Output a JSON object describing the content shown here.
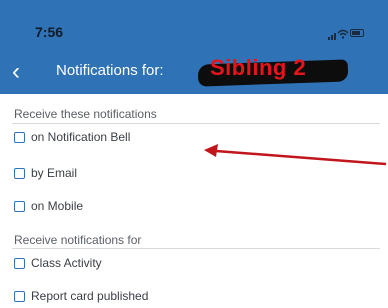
{
  "status_bar": {
    "time": "7:56"
  },
  "nav": {
    "back_icon": "chevron-left-icon",
    "title": "Notifications for:",
    "child_name": "Sibling 2"
  },
  "sections": [
    {
      "header": "Receive these notifications",
      "options": [
        "on Notification Bell",
        "by Email",
        "on Mobile"
      ]
    },
    {
      "header": "Receive notifications for",
      "options": [
        "Class Activity",
        "Report card published"
      ]
    }
  ],
  "colors": {
    "header_bg": "#2f72b6",
    "annotation_red": "#c0161c"
  }
}
